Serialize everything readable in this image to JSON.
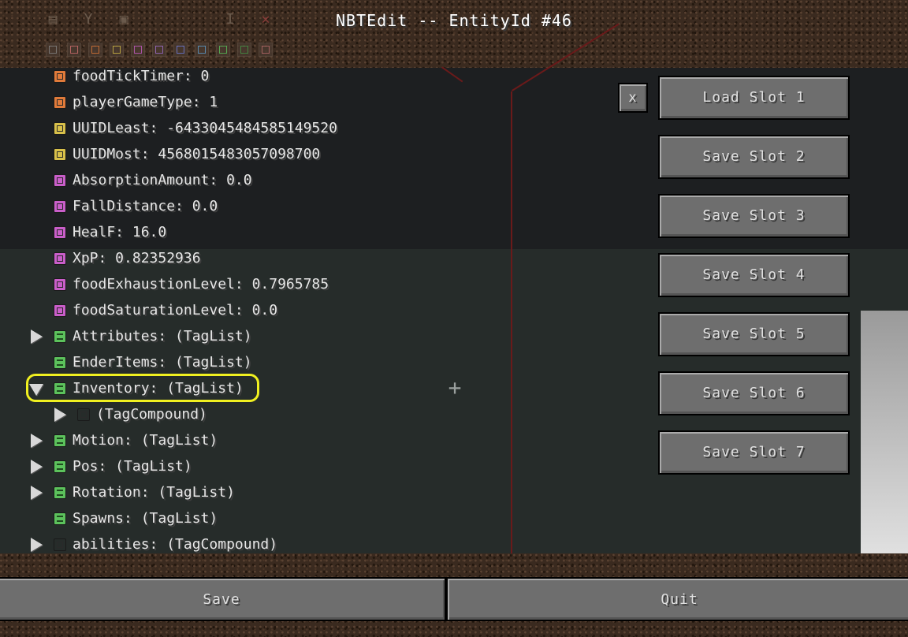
{
  "window": {
    "title": "NBTEdit -- EntityId #46"
  },
  "toolbar": {
    "icons": [
      "copy-icon",
      "cut-icon",
      "paste-icon",
      "edit-icon",
      "delete-icon"
    ],
    "tag_types": [
      "byte",
      "short",
      "int",
      "long",
      "float",
      "double",
      "byte-array",
      "string",
      "list",
      "compound",
      "int-array"
    ]
  },
  "tree": {
    "rows": [
      {
        "label": "foodTickTimer: 0",
        "type": "int",
        "indent": 0,
        "arrow": "none"
      },
      {
        "label": "playerGameType: 1",
        "type": "int",
        "indent": 0,
        "arrow": "none"
      },
      {
        "label": "UUIDLeast: -6433045484585149520",
        "type": "long",
        "indent": 0,
        "arrow": "none"
      },
      {
        "label": "UUIDMost: 4568015483057098700",
        "type": "long",
        "indent": 0,
        "arrow": "none"
      },
      {
        "label": "AbsorptionAmount: 0.0",
        "type": "float",
        "indent": 0,
        "arrow": "none"
      },
      {
        "label": "FallDistance: 0.0",
        "type": "float",
        "indent": 0,
        "arrow": "none"
      },
      {
        "label": "HealF: 16.0",
        "type": "float",
        "indent": 0,
        "arrow": "none"
      },
      {
        "label": "XpP: 0.82352936",
        "type": "float",
        "indent": 0,
        "arrow": "none"
      },
      {
        "label": "foodExhaustionLevel: 0.7965785",
        "type": "float",
        "indent": 0,
        "arrow": "none"
      },
      {
        "label": "foodSaturationLevel: 0.0",
        "type": "float",
        "indent": 0,
        "arrow": "none"
      },
      {
        "label": "Attributes: (TagList)",
        "type": "list",
        "indent": 0,
        "arrow": "closed"
      },
      {
        "label": "EnderItems: (TagList)",
        "type": "list",
        "indent": 0,
        "arrow": "none"
      },
      {
        "label": "Inventory: (TagList)",
        "type": "list",
        "indent": 0,
        "arrow": "open"
      },
      {
        "label": "(TagCompound)",
        "type": "compound",
        "indent": 1,
        "arrow": "closed"
      },
      {
        "label": "Motion: (TagList)",
        "type": "list",
        "indent": 0,
        "arrow": "closed"
      },
      {
        "label": "Pos: (TagList)",
        "type": "list",
        "indent": 0,
        "arrow": "closed"
      },
      {
        "label": "Rotation: (TagList)",
        "type": "list",
        "indent": 0,
        "arrow": "closed"
      },
      {
        "label": "Spawns: (TagList)",
        "type": "list",
        "indent": 0,
        "arrow": "none"
      },
      {
        "label": "abilities: (TagCompound)",
        "type": "compound",
        "indent": 0,
        "arrow": "closed"
      }
    ]
  },
  "save_slots": {
    "close_label": "x",
    "buttons": [
      "Load Slot 1",
      "Save Slot 2",
      "Save Slot 3",
      "Save Slot 4",
      "Save Slot 5",
      "Save Slot 6",
      "Save Slot 7"
    ]
  },
  "footer": {
    "save_label": "Save",
    "quit_label": "Quit"
  },
  "colors": {
    "int": "#e07a3a",
    "long": "#d8c04a",
    "float": "#c95ec9",
    "list": "#5cc25c",
    "compound": "#4a9a4a",
    "highlight": "#f0f020"
  }
}
